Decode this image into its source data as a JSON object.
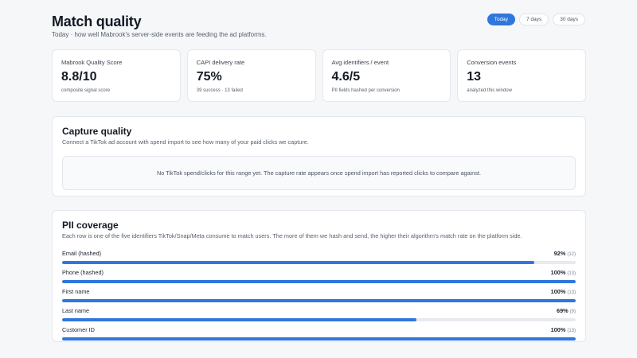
{
  "page": {
    "title": "Match quality",
    "subtitle": "Today · how well Mabrook's server-side events are feeding the ad platforms."
  },
  "range_selector": {
    "options": [
      {
        "label": "Today",
        "active": true
      },
      {
        "label": "7 days",
        "active": false
      },
      {
        "label": "30 days",
        "active": false
      }
    ]
  },
  "stats": [
    {
      "label": "Mabrook Quality Score",
      "value": "8.8/10",
      "sub": "composite signal score"
    },
    {
      "label": "CAPI delivery rate",
      "value": "75%",
      "sub": "39 success · 13 failed"
    },
    {
      "label": "Avg identifiers / event",
      "value": "4.6/5",
      "sub": "PII fields hashed per conversion"
    },
    {
      "label": "Conversion events",
      "value": "13",
      "sub": "analyzed this window"
    }
  ],
  "capture_quality": {
    "title": "Capture quality",
    "description": "Connect a TikTok ad account with spend import to see how many of your paid clicks we capture.",
    "empty_message": "No TikTok spend/clicks for this range yet. The capture rate appears once spend import has reported clicks to compare against."
  },
  "pii_coverage": {
    "title": "PII coverage",
    "description": "Each row is one of the five identifiers TikTok/Snap/Meta consume to match users. The more of them we hash and send, the higher their algorithm's match rate on the platform side.",
    "rows": [
      {
        "name": "Email (hashed)",
        "percent_label": "92%",
        "count_label": "(12)",
        "fraction": 0.92
      },
      {
        "name": "Phone (hashed)",
        "percent_label": "100%",
        "count_label": "(13)",
        "fraction": 1.0
      },
      {
        "name": "First name",
        "percent_label": "100%",
        "count_label": "(13)",
        "fraction": 1.0
      },
      {
        "name": "Last name",
        "percent_label": "69%",
        "count_label": "(9)",
        "fraction": 0.69
      },
      {
        "name": "Customer ID",
        "percent_label": "100%",
        "count_label": "(13)",
        "fraction": 1.0
      }
    ]
  },
  "colors": {
    "accent": "#2f77dc",
    "track": "#e7eaf0",
    "page_bg": "#f6f7f9"
  }
}
